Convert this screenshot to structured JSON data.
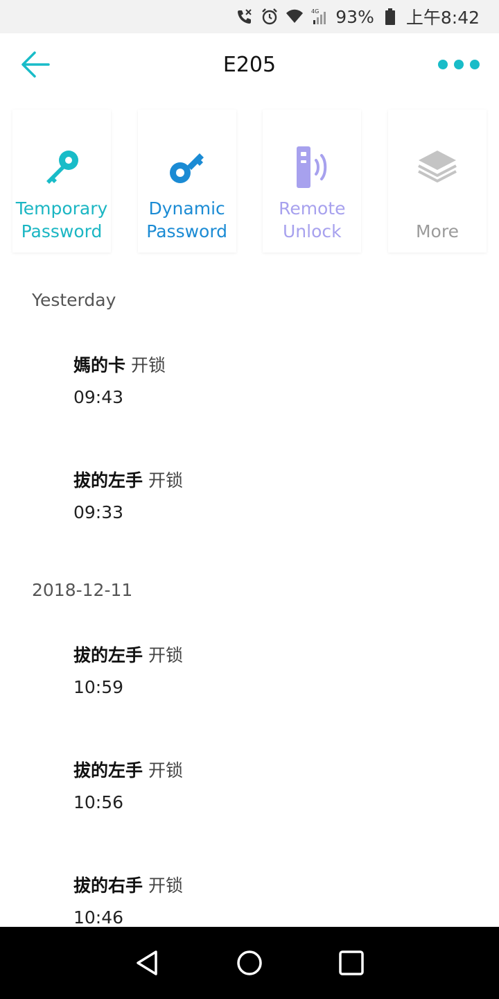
{
  "status_bar": {
    "battery_percent": "93%",
    "time": "上午8:42",
    "network": "4G"
  },
  "header": {
    "title": "E205"
  },
  "actions": [
    {
      "label": "Temporary\nPassword",
      "icon": "key-icon",
      "color": "#1bb6c3"
    },
    {
      "label": "Dynamic\nPassword",
      "icon": "dynamic-key-icon",
      "color": "#1b8bd4"
    },
    {
      "label": "Remote\nUnlock",
      "icon": "remote-unlock-icon",
      "color": "#a7a1ee"
    },
    {
      "label": "More",
      "icon": "layers-icon",
      "color": "#9b9b9b"
    }
  ],
  "log": {
    "sections": [
      {
        "header": "Yesterday",
        "items": [
          {
            "name": "媽的卡",
            "action": "开锁",
            "time": "09:43"
          },
          {
            "name": "拔的左手",
            "action": "开锁",
            "time": "09:33"
          }
        ]
      },
      {
        "header": "2018-12-11",
        "items": [
          {
            "name": "拔的左手",
            "action": "开锁",
            "time": "10:59"
          },
          {
            "name": "拔的左手",
            "action": "开锁",
            "time": "10:56"
          },
          {
            "name": "拔的右手",
            "action": "开锁",
            "time": "10:46"
          }
        ]
      }
    ]
  },
  "colors": {
    "accent": "#19bcc8",
    "dynamic": "#1b8bd4",
    "remote": "#a7a1ee",
    "more": "#9b9b9b"
  }
}
